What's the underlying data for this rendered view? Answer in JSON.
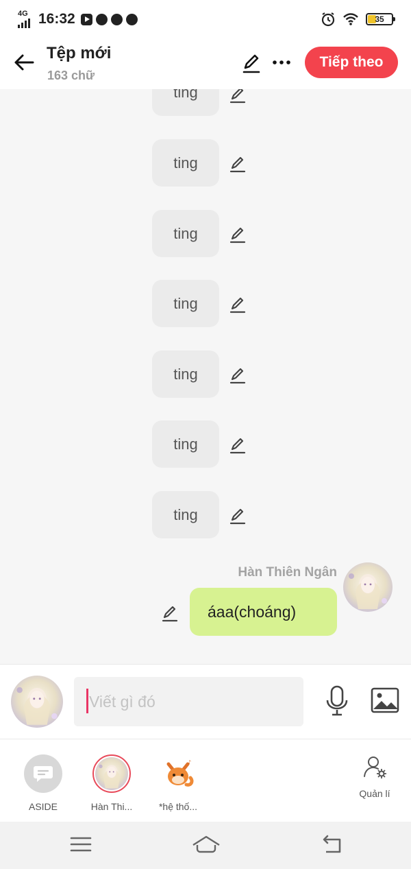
{
  "status_bar": {
    "network": "4G",
    "time": "16:32",
    "battery_level": "35",
    "battery_color": "#f0c42a",
    "app_icons": [
      "youtube-icon",
      "messenger-icon",
      "chrome-icon",
      "clock-icon"
    ],
    "right_icons": [
      "alarm-icon",
      "wifi-icon",
      "battery-icon"
    ]
  },
  "header": {
    "title": "Tệp mới",
    "subtitle": "163 chữ",
    "next_label": "Tiếp theo",
    "accent_color": "#f3434d"
  },
  "chat": {
    "bubbles": [
      {
        "text": "ting"
      },
      {
        "text": "ting"
      },
      {
        "text": "ting"
      },
      {
        "text": "ting"
      },
      {
        "text": "ting"
      },
      {
        "text": "ting"
      },
      {
        "text": "ting"
      }
    ],
    "my_message": {
      "sender": "Hàn Thiên Ngân",
      "text": "áaa(choáng)",
      "bubble_color": "#d7f291"
    }
  },
  "composer": {
    "placeholder": "Viết gì đó",
    "value": ""
  },
  "characters": [
    {
      "label": "ASIDE"
    },
    {
      "label": "Hàn Thi..."
    },
    {
      "label": "*hệ thố..."
    }
  ],
  "manage": {
    "label": "Quản lí"
  },
  "nav": [
    "menu-icon",
    "home-icon",
    "back-nav-icon"
  ]
}
